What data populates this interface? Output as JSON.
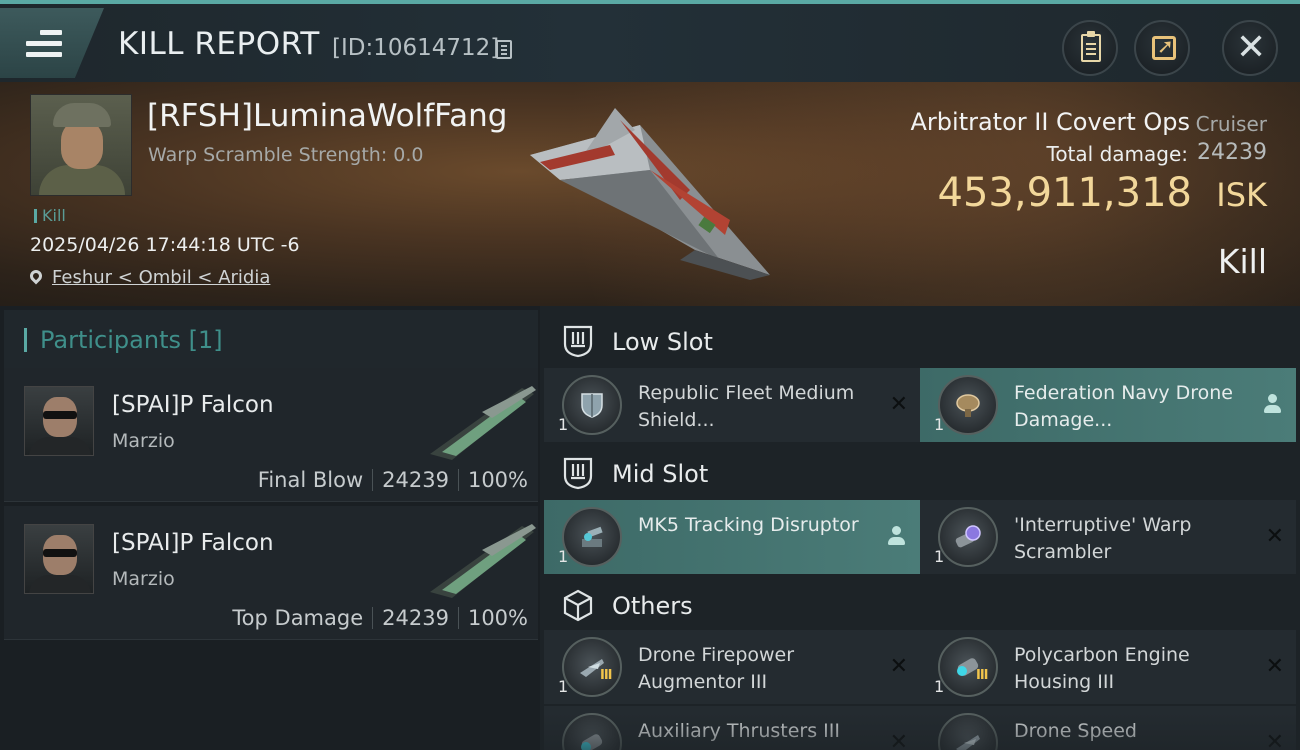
{
  "header": {
    "title": "KILL REPORT",
    "id_text": "[ID:10614712]",
    "icons": [
      "menu-icon",
      "copy-icon",
      "clipboard-icon",
      "share-icon",
      "close-icon"
    ]
  },
  "victim": {
    "name": "[RFSH]LuminaWolfFang",
    "warp_scramble": "Warp Scramble Strength: 0.0",
    "tag": "Kill",
    "datetime": "2025/04/26 17:44:18 UTC -6",
    "location": "Feshur < Ombil < Aridia",
    "ship_name": "Arbitrator II Covert Ops",
    "ship_class": "Cruiser",
    "total_damage_label": "Total damage:",
    "total_damage": "24239",
    "isk_value": "453,911,318",
    "isk_unit": "ISK",
    "result": "Kill"
  },
  "participants": {
    "title": "Participants [1]",
    "items": [
      {
        "name": "[SPAI]P Falcon",
        "corp": "Marzio",
        "role": "Final Blow",
        "damage": "24239",
        "percent": "100%"
      },
      {
        "name": "[SPAI]P Falcon",
        "corp": "Marzio",
        "role": "Top Damage",
        "damage": "24239",
        "percent": "100%"
      }
    ]
  },
  "fitting": {
    "low_slot": {
      "title": "Low Slot",
      "items": [
        {
          "qty": "1",
          "name": "Republic Fleet Medium Shield...",
          "highlight": false,
          "action": "x"
        },
        {
          "qty": "1",
          "name": "Federation Navy Drone Damage...",
          "highlight": true,
          "action": "person"
        }
      ]
    },
    "mid_slot": {
      "title": "Mid Slot",
      "items": [
        {
          "qty": "1",
          "name": "MK5 Tracking Disruptor",
          "highlight": true,
          "action": "person"
        },
        {
          "qty": "1",
          "name": "'Interruptive' Warp Scrambler",
          "highlight": false,
          "action": "x"
        }
      ]
    },
    "others": {
      "title": "Others",
      "items": [
        {
          "qty": "1",
          "name": "Drone Firepower Augmentor III",
          "highlight": false,
          "action": "x"
        },
        {
          "qty": "1",
          "name": "Polycarbon Engine Housing III",
          "highlight": false,
          "action": "x"
        },
        {
          "qty": "",
          "name": "Auxiliary Thrusters III",
          "highlight": false,
          "action": "x"
        },
        {
          "qty": "",
          "name": "Drone Speed",
          "highlight": false,
          "action": "x"
        }
      ]
    }
  },
  "colors": {
    "accent": "#5aa9a4",
    "isk": "#f2d79a",
    "highlight_row": "#4b7c78"
  }
}
